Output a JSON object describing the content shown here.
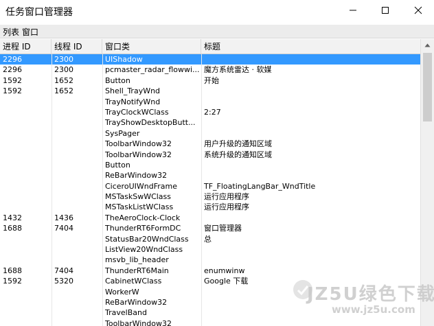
{
  "window": {
    "title": "任务窗口管理器"
  },
  "menu": {
    "items": [
      "列表",
      "窗口"
    ]
  },
  "table": {
    "columns": [
      "进程 ID",
      "线程 ID",
      "窗口类",
      "标题"
    ],
    "rows": [
      {
        "pid": "2296",
        "tid": "2300",
        "cls": "UIShadow",
        "title": "",
        "selected": true
      },
      {
        "pid": "2296",
        "tid": "2300",
        "cls": "pcmaster_radar_flowwi...",
        "title": "魔方系统雷达 · 软媒"
      },
      {
        "pid": "1592",
        "tid": "1652",
        "cls": "Button",
        "title": "开始"
      },
      {
        "pid": "1592",
        "tid": "1652",
        "cls": "Shell_TrayWnd",
        "title": ""
      },
      {
        "pid": "",
        "tid": "",
        "cls": "TrayNotifyWnd",
        "title": ""
      },
      {
        "pid": "",
        "tid": "",
        "cls": "TrayClockWClass",
        "title": "2:27"
      },
      {
        "pid": "",
        "tid": "",
        "cls": "TrayShowDesktopButt...",
        "title": ""
      },
      {
        "pid": "",
        "tid": "",
        "cls": "SysPager",
        "title": ""
      },
      {
        "pid": "",
        "tid": "",
        "cls": "ToolbarWindow32",
        "title": "用户升级的通知区域"
      },
      {
        "pid": "",
        "tid": "",
        "cls": "ToolbarWindow32",
        "title": "系统升级的通知区域"
      },
      {
        "pid": "",
        "tid": "",
        "cls": "Button",
        "title": ""
      },
      {
        "pid": "",
        "tid": "",
        "cls": "ReBarWindow32",
        "title": ""
      },
      {
        "pid": "",
        "tid": "",
        "cls": "CiceroUIWndFrame",
        "title": "TF_FloatingLangBar_WndTitle"
      },
      {
        "pid": "",
        "tid": "",
        "cls": "MSTaskSwWClass",
        "title": "运行应用程序"
      },
      {
        "pid": "",
        "tid": "",
        "cls": "MSTaskListWClass",
        "title": "运行应用程序"
      },
      {
        "pid": "1432",
        "tid": "1436",
        "cls": "TheAeroClock-Clock",
        "title": ""
      },
      {
        "pid": "1688",
        "tid": "7404",
        "cls": "ThunderRT6FormDC",
        "title": "窗口管理器"
      },
      {
        "pid": "",
        "tid": "",
        "cls": "StatusBar20WndClass",
        "title": "总"
      },
      {
        "pid": "",
        "tid": "",
        "cls": "ListView20WndClass",
        "title": ""
      },
      {
        "pid": "",
        "tid": "",
        "cls": "msvb_lib_header",
        "title": ""
      },
      {
        "pid": "1688",
        "tid": "7404",
        "cls": "ThunderRT6Main",
        "title": "enumwinw"
      },
      {
        "pid": "1592",
        "tid": "5320",
        "cls": "CabinetWClass",
        "title": "Google 下载"
      },
      {
        "pid": "",
        "tid": "",
        "cls": "WorkerW",
        "title": ""
      },
      {
        "pid": "",
        "tid": "",
        "cls": "ReBarWindow32",
        "title": ""
      },
      {
        "pid": "",
        "tid": "",
        "cls": "TravelBand",
        "title": ""
      },
      {
        "pid": "",
        "tid": "",
        "cls": "ToolbarWindow32",
        "title": ""
      }
    ]
  },
  "watermark": {
    "main": "JZ5U绿色下载",
    "sub": "www.jz5u.com"
  },
  "colors": {
    "selection": "#3399ff",
    "header_bg": "#f2f2f2",
    "menubar_bg": "#ececec"
  },
  "icons": {
    "minimize": "minimize-icon",
    "maximize": "maximize-icon",
    "close": "close-icon",
    "scroll_up": "scroll-up-arrow-icon"
  }
}
